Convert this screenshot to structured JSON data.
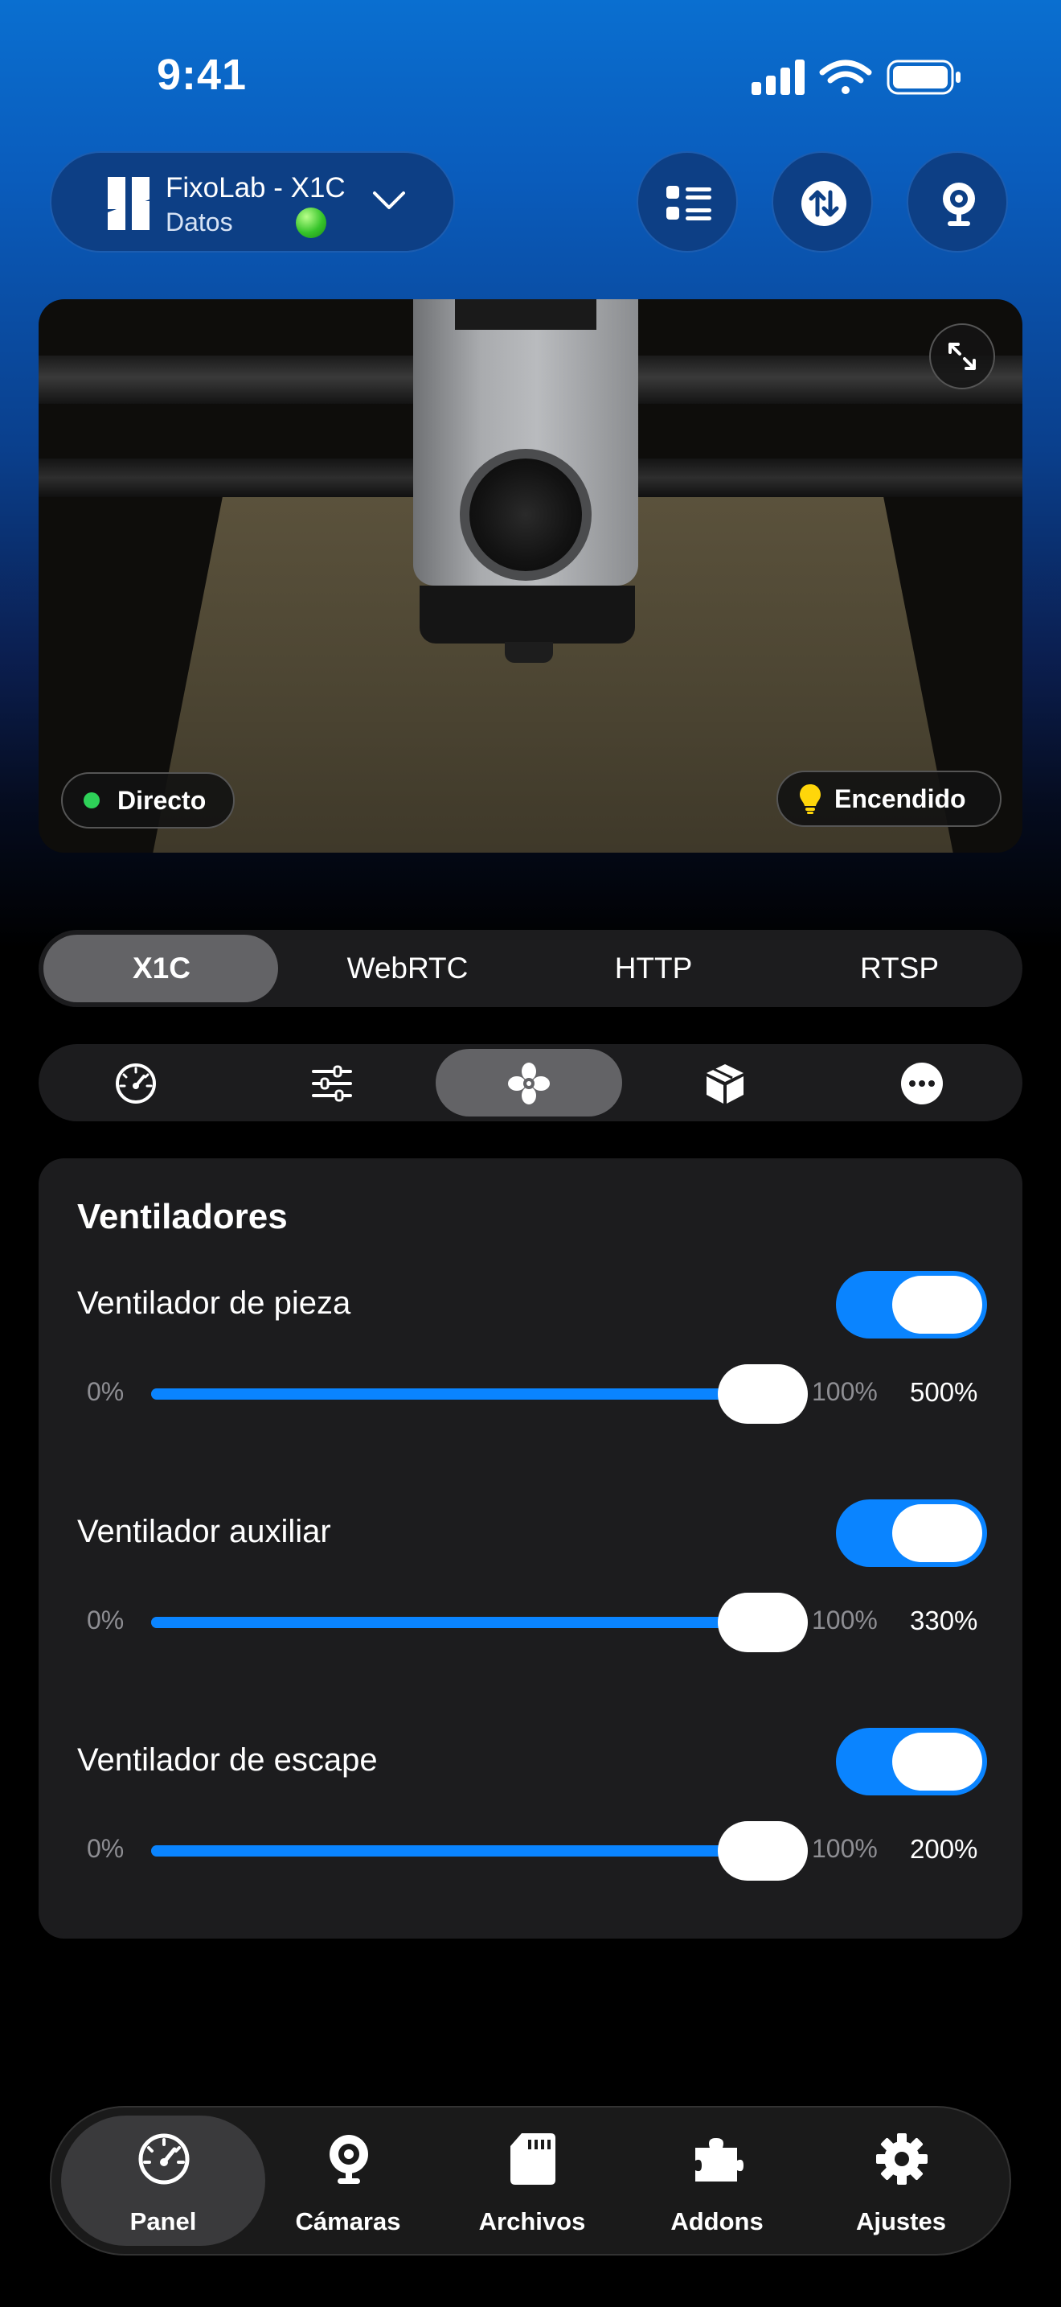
{
  "status_bar": {
    "time": "9:41"
  },
  "header": {
    "device_name": "FixoLab - X1C",
    "device_status": "Datos"
  },
  "camera": {
    "live_label": "Directo",
    "light_label": "Encendido"
  },
  "stream_tabs": [
    {
      "label": "X1C",
      "selected": true
    },
    {
      "label": "WebRTC",
      "selected": false
    },
    {
      "label": "HTTP",
      "selected": false
    },
    {
      "label": "RTSP",
      "selected": false
    }
  ],
  "control_tabs": [
    {
      "icon": "speedometer-icon",
      "selected": false
    },
    {
      "icon": "sliders-icon",
      "selected": false
    },
    {
      "icon": "fan-icon",
      "selected": true
    },
    {
      "icon": "cube-icon",
      "selected": false
    },
    {
      "icon": "more-icon",
      "selected": false
    }
  ],
  "fans_card": {
    "title": "Ventiladores",
    "fans": [
      {
        "label": "Ventilador de pieza",
        "enabled": true,
        "min": "0%",
        "max": "100%",
        "value": "500%",
        "slider_fraction": 0.94
      },
      {
        "label": "Ventilador auxiliar",
        "enabled": true,
        "min": "0%",
        "max": "100%",
        "value": "330%",
        "slider_fraction": 0.94
      },
      {
        "label": "Ventilador de escape",
        "enabled": true,
        "min": "0%",
        "max": "100%",
        "value": "200%",
        "slider_fraction": 0.94
      }
    ]
  },
  "bottom_nav": [
    {
      "label": "Panel",
      "icon": "speedometer-icon",
      "selected": true
    },
    {
      "label": "Cámaras",
      "icon": "webcam-icon",
      "selected": false
    },
    {
      "label": "Archivos",
      "icon": "sd-card-icon",
      "selected": false
    },
    {
      "label": "Addons",
      "icon": "puzzle-icon",
      "selected": false
    },
    {
      "label": "Ajustes",
      "icon": "gear-icon",
      "selected": false
    }
  ],
  "colors": {
    "accent": "#0a84ff",
    "header_blue": "#0a6fd0",
    "card_bg": "#1c1c1e",
    "status_green": "#2ed158"
  }
}
